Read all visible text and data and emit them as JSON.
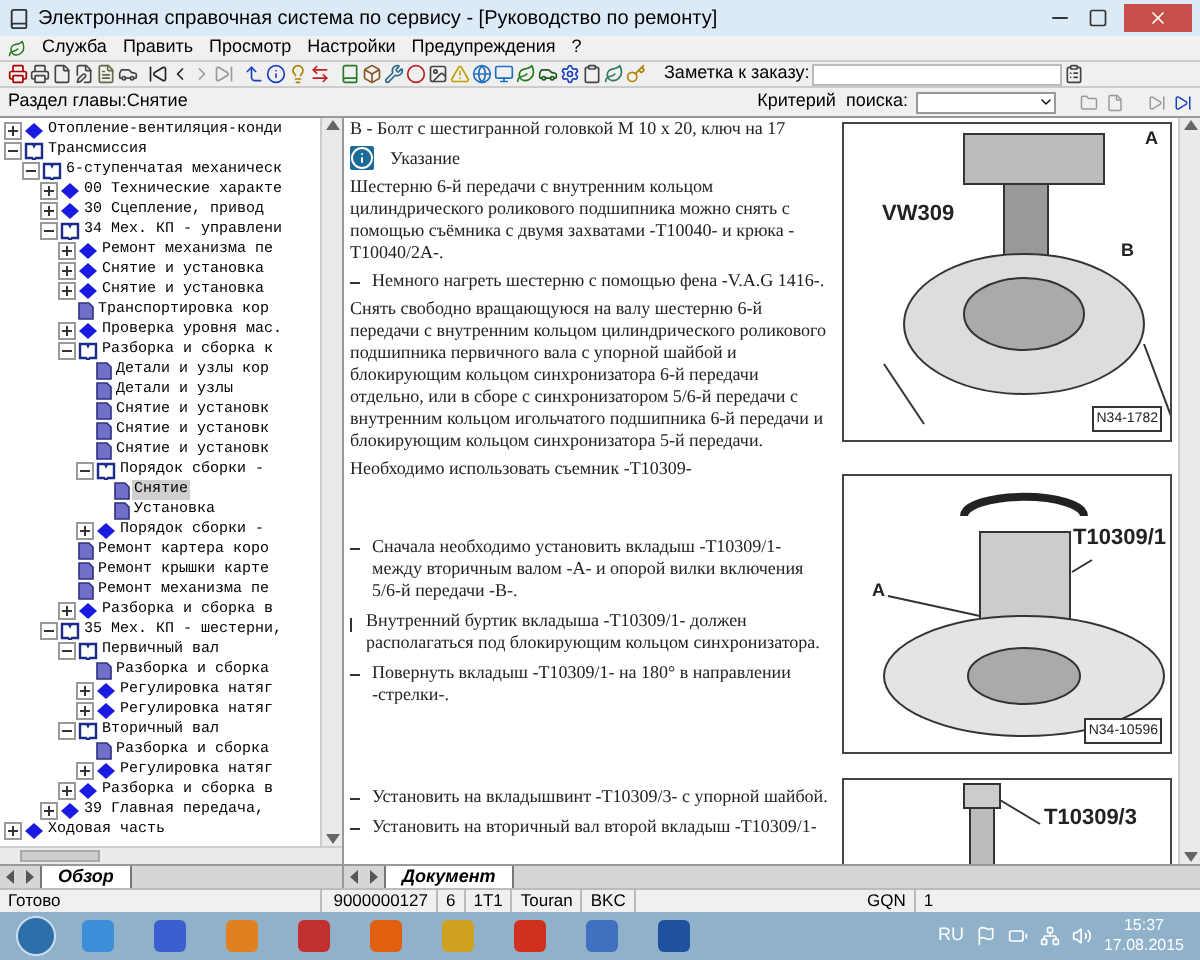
{
  "window": {
    "title": "Электронная справочная система по сервису - [Руководство по ремонту]"
  },
  "menu": [
    "Служба",
    "Править",
    "Просмотр",
    "Настройки",
    "Предупреждения",
    "?"
  ],
  "toolbar": {
    "note_label": "Заметка к заказу:"
  },
  "section_bar": {
    "label": "Раздел главы:Снятие",
    "search_label": "Критерий  поиска:"
  },
  "tree": [
    {
      "label": "Отопление-вентиляция-конди",
      "kind": "topic",
      "expanded": false
    },
    {
      "label": "Трансмиссия",
      "kind": "book",
      "expanded": true,
      "children": [
        {
          "label": "6-ступенчатая механическ",
          "kind": "book",
          "expanded": true,
          "children": [
            {
              "label": "00 Технические характе",
              "kind": "topic",
              "expanded": false
            },
            {
              "label": "30 Сцепление, привод",
              "kind": "topic",
              "expanded": false
            },
            {
              "label": "34 Мех. КП - управлени",
              "kind": "book",
              "expanded": true,
              "children": [
                {
                  "label": "Ремонт механизма пе",
                  "kind": "topic",
                  "expanded": false
                },
                {
                  "label": "Снятие и установка",
                  "kind": "topic",
                  "expanded": false
                },
                {
                  "label": "Снятие и установка",
                  "kind": "topic",
                  "expanded": false
                },
                {
                  "label": "Транспортировка кор",
                  "kind": "page",
                  "selected": false
                },
                {
                  "label": "Проверка уровня мас.",
                  "kind": "topic",
                  "expanded": false
                },
                {
                  "label": "Разборка и сборка к",
                  "kind": "book",
                  "expanded": true,
                  "children": [
                    {
                      "label": "Детали и узлы кор",
                      "kind": "page",
                      "selected": false
                    },
                    {
                      "label": "Детали и узлы",
                      "kind": "page",
                      "selected": false
                    },
                    {
                      "label": "Снятие и установк",
                      "kind": "page",
                      "selected": false
                    },
                    {
                      "label": "Снятие и установк",
                      "kind": "page",
                      "selected": false
                    },
                    {
                      "label": "Снятие и установк",
                      "kind": "page",
                      "selected": false
                    },
                    {
                      "label": "Порядок сборки -",
                      "kind": "book",
                      "expanded": true,
                      "children": [
                        {
                          "label": "Снятие",
                          "kind": "page",
                          "selected": true
                        },
                        {
                          "label": "Установка",
                          "kind": "page",
                          "selected": false
                        }
                      ]
                    },
                    {
                      "label": "Порядок сборки -",
                      "kind": "topic",
                      "expanded": false
                    }
                  ]
                },
                {
                  "label": "Ремонт картера коро",
                  "kind": "page",
                  "selected": false
                },
                {
                  "label": "Ремонт крышки карте",
                  "kind": "page",
                  "selected": false
                },
                {
                  "label": "Ремонт механизма пе",
                  "kind": "page",
                  "selected": false
                },
                {
                  "label": "Разборка и сборка в",
                  "kind": "topic",
                  "expanded": false
                }
              ]
            },
            {
              "label": "35 Мех. КП - шестерни,",
              "kind": "book",
              "expanded": true,
              "children": [
                {
                  "label": "Первичный вал",
                  "kind": "book",
                  "expanded": true,
                  "children": [
                    {
                      "label": "Разборка и сборка",
                      "kind": "page",
                      "selected": false
                    },
                    {
                      "label": "Регулировка натяг",
                      "kind": "topic",
                      "expanded": false
                    },
                    {
                      "label": "Регулировка натяг",
                      "kind": "topic",
                      "expanded": false
                    }
                  ]
                },
                {
                  "label": "Вторичный вал",
                  "kind": "book",
                  "expanded": true,
                  "children": [
                    {
                      "label": "Разборка и сборка",
                      "kind": "page",
                      "selected": false
                    },
                    {
                      "label": "Регулировка натяг",
                      "kind": "topic",
                      "expanded": false
                    }
                  ]
                },
                {
                  "label": "Разборка и сборка в",
                  "kind": "topic",
                  "expanded": false
                }
              ]
            },
            {
              "label": "39 Главная передача,",
              "kind": "topic",
              "expanded": false
            }
          ]
        }
      ]
    },
    {
      "label": "Ходовая часть",
      "kind": "topic",
      "expanded": false
    }
  ],
  "left_tabs": [
    {
      "label": "Обзор",
      "selected": true
    }
  ],
  "document": {
    "top": [
      {
        "kind": "para",
        "text": "B - Болт с шестигранной головкой M 10 x 20, ключ на 17"
      },
      {
        "kind": "note",
        "text": "Указание"
      },
      {
        "kind": "para",
        "text": "Шестерню 6-й передачи с внутренним кольцом цилиндрического роликового подшипника можно снять с помощью съёмника с двумя захватами -T10040- и крюка -T10040/2A-."
      },
      {
        "kind": "step",
        "text": "Немного нагреть шестерню с помощью фена -V.A.G 1416-."
      },
      {
        "kind": "para",
        "text": "Снять свободно вращающуюся на валу шестерню 6-й передачи с внутренним кольцом цилиндрического роликового подшипника первичного вала с упорной шайбой и блокирующим кольцом синхронизатора 6-й передачи отдельно, или в сборе с синхронизатором 5/6-й передачи с внутренним кольцом игольчатого подшипника 6-й передачи и блокирующим кольцом синхронизатора 5-й передачи."
      },
      {
        "kind": "para",
        "text": "Необходимо использовать съемник -T10309-"
      }
    ],
    "middle": [
      {
        "kind": "step",
        "text": "Сначала необходимо установить вкладыш -T10309/1- между вторичным валом -A- и опорой вилки включения 5/6-й передачи -B-."
      },
      {
        "kind": "info",
        "text": "Внутренний буртик вкладыша -T10309/1- должен располагаться под блокирующим кольцом синхронизатора."
      },
      {
        "kind": "step",
        "text": "Повернуть вкладыш -T10309/1- на 180° в направлении -стрелки-."
      }
    ],
    "bottom": [
      {
        "kind": "step",
        "text": "Установить на вкладышвинт -T10309/3- с упорной шайбой."
      },
      {
        "kind": "step",
        "text": "Установить на вторичный вал второй вкладыш -T10309/1-"
      }
    ],
    "figures": [
      {
        "labels": [
          "VW309",
          "A",
          "B",
          "N34-1782"
        ]
      },
      {
        "labels": [
          "T10309/1",
          "A",
          "N34-10596"
        ]
      },
      {
        "labels": [
          "T10309/3"
        ]
      }
    ]
  },
  "doc_tabs": [
    {
      "label": "Документ",
      "selected": true
    }
  ],
  "status_bar": {
    "ready": "Готово",
    "fields": [
      "9000000127",
      "6",
      "1T1",
      "Touran",
      "BKC",
      "GQN",
      "1"
    ]
  },
  "taskbar": {
    "language": "RU",
    "time": "15:37",
    "date": "17.08.2015"
  }
}
